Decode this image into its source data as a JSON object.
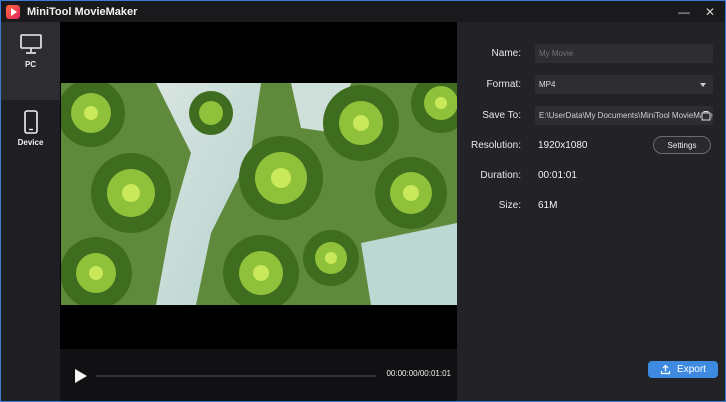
{
  "window": {
    "title": "MiniTool MovieMaker",
    "minimize_glyph": "—",
    "close_glyph": "✕"
  },
  "sidebar": {
    "items": [
      {
        "label": "PC",
        "icon": "monitor-icon",
        "active": true
      },
      {
        "label": "Device",
        "icon": "smartphone-icon",
        "active": false
      }
    ]
  },
  "player": {
    "timecode": "00:00:00/00:01:01",
    "progress": 0,
    "thumbnail": "aerial-palm-trees"
  },
  "export_settings": {
    "name_label": "Name:",
    "name_placeholder": "My Movie",
    "format_label": "Format:",
    "format_value": "MP4",
    "saveto_label": "Save To:",
    "saveto_value": "E:\\UserData\\My Documents\\MiniTool MovieMaker",
    "resolution_label": "Resolution:",
    "resolution_value": "1920x1080",
    "settings_button": "Settings",
    "duration_label": "Duration:",
    "duration_value": "00:01:01",
    "size_label": "Size:",
    "size_value": "61M"
  },
  "export_button": "Export",
  "colors": {
    "accent": "#3d8ae0",
    "background": "#232327",
    "sidebar": "#1f1f23",
    "active_item": "#2c2c31"
  }
}
